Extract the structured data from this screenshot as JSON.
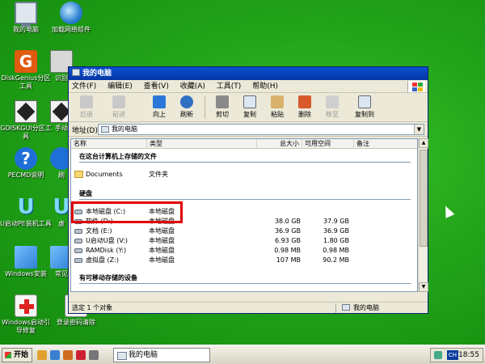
{
  "desktop_icons": [
    {
      "label": "我的电脑",
      "icon": "my-computer-icon"
    },
    {
      "label": "加载网络组件",
      "icon": "network-globe-icon"
    },
    {
      "label": "DiskGenius分区工具",
      "icon": "diskgenius-icon"
    },
    {
      "label": "识别",
      "icon": "printer-icon"
    },
    {
      "label": "GDISKGUI分区工具",
      "icon": "gdisk-icon"
    },
    {
      "label": "手动",
      "icon": "tool-icon"
    },
    {
      "label": "PECMD说明",
      "icon": "help-icon"
    },
    {
      "label": "刷",
      "icon": "tool-icon"
    },
    {
      "label": "U启动PE装机工具",
      "icon": "u-boot-icon"
    },
    {
      "label": "虚",
      "icon": "tool-icon"
    },
    {
      "label": "Windows安装",
      "icon": "windows-install-icon"
    },
    {
      "label": "常见",
      "icon": "tool-icon"
    },
    {
      "label": "Windows启动引导修复",
      "icon": "first-aid-kit-icon"
    },
    {
      "label": "登录密码清除",
      "icon": "password-clear-icon"
    }
  ],
  "window": {
    "title": "我的电脑",
    "menu": [
      "文件(F)",
      "编辑(E)",
      "查看(V)",
      "收藏(A)",
      "工具(T)",
      "帮助(H)"
    ],
    "toolbar": [
      {
        "label": "后退",
        "icon": "back-arrow-icon",
        "enabled": false
      },
      {
        "label": "前进",
        "icon": "forward-arrow-icon",
        "enabled": false
      },
      {
        "label": "向上",
        "icon": "up-arrow-icon",
        "enabled": true
      },
      {
        "label": "刷新",
        "icon": "refresh-icon",
        "enabled": true
      },
      {
        "label": "剪切",
        "icon": "scissors-icon",
        "enabled": true
      },
      {
        "label": "复制",
        "icon": "copy-icon",
        "enabled": true
      },
      {
        "label": "粘贴",
        "icon": "paste-icon",
        "enabled": true
      },
      {
        "label": "删除",
        "icon": "delete-icon",
        "enabled": true
      },
      {
        "label": "移至",
        "icon": "move-to-icon",
        "enabled": false
      },
      {
        "label": "复制到",
        "icon": "copy-to-icon",
        "enabled": true
      }
    ],
    "address": {
      "label": "地址(D)",
      "value": "我的电脑"
    },
    "columns": [
      "名称",
      "类型",
      "总大小",
      "可用空间",
      "备注"
    ],
    "groups": {
      "files": "在这台计算机上存储的文件",
      "hard_disks": "硬盘",
      "removable": "有可移动存储的设备"
    },
    "file_items": [
      {
        "name": "Documents",
        "type": "文件夹",
        "total": "",
        "free": ""
      }
    ],
    "disks": [
      {
        "name": "本地磁盘 (C:)",
        "type": "本地磁盘",
        "total": "",
        "free": ""
      },
      {
        "name": "软件 (D:)",
        "type": "本地磁盘",
        "total": "38.0 GB",
        "free": "37.9 GB"
      },
      {
        "name": "文档 (E:)",
        "type": "本地磁盘",
        "total": "36.9 GB",
        "free": "36.9 GB"
      },
      {
        "name": "U启动U盘 (V:)",
        "type": "本地磁盘",
        "total": "6.93 GB",
        "free": "1.80 GB"
      },
      {
        "name": "RAMDisk (Y:)",
        "type": "本地磁盘",
        "total": "0.98 MB",
        "free": "0.98 MB"
      },
      {
        "name": "虚拟盘 (Z:)",
        "type": "本地磁盘",
        "total": "107 MB",
        "free": "90.2 MB"
      }
    ],
    "status_left": "选定 1 个对象",
    "status_right": "我的电脑"
  },
  "taskbar": {
    "start_label": "开始",
    "task_button": "我的电脑",
    "lang_indicator": "CH",
    "clock": "18:55"
  },
  "colors": {
    "desktop": "#23a51a",
    "highlight_box": "#e00000",
    "titlebar": "#0a4fd0"
  }
}
